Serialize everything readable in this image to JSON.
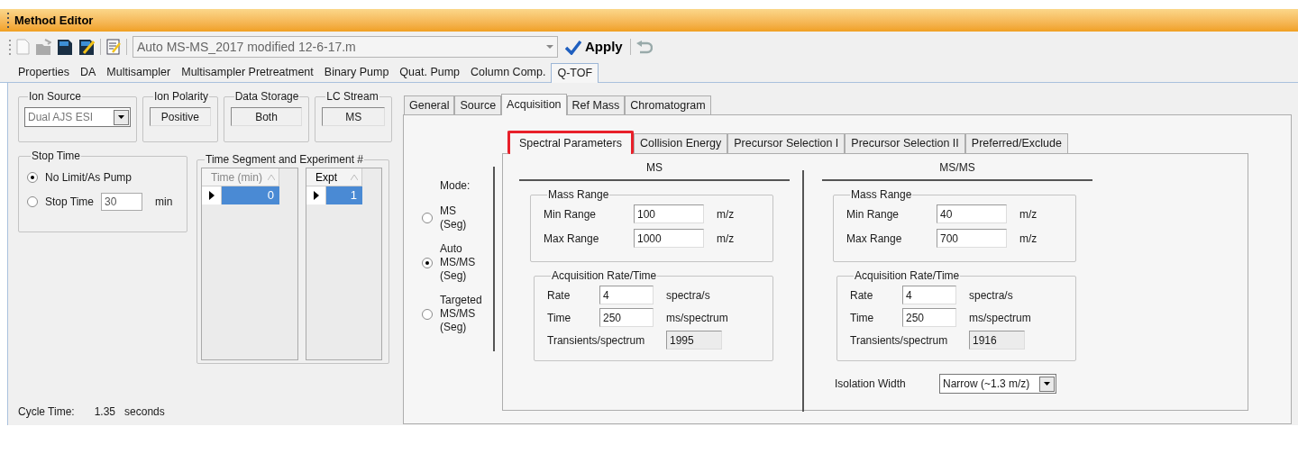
{
  "window": {
    "title": "Method Editor"
  },
  "toolbar": {
    "method_file": "Auto MS-MS_2017 modified 12-6-17.m",
    "apply_button": "Apply"
  },
  "device_tabs": [
    {
      "label": "Properties",
      "selected": false
    },
    {
      "label": "DA",
      "selected": false
    },
    {
      "label": "Multisampler",
      "selected": false
    },
    {
      "label": "Multisampler Pretreatment",
      "selected": false
    },
    {
      "label": "Binary Pump",
      "selected": false
    },
    {
      "label": "Quat. Pump",
      "selected": false
    },
    {
      "label": "Column Comp.",
      "selected": false
    },
    {
      "label": "Q-TOF",
      "selected": true
    }
  ],
  "ion_source": {
    "label": "Ion Source",
    "value": "Dual AJS ESI"
  },
  "status_groups": [
    {
      "label": "Ion Polarity",
      "value": "Positive"
    },
    {
      "label": "Data Storage",
      "value": "Both"
    },
    {
      "label": "LC Stream",
      "value": "MS"
    }
  ],
  "stop_time": {
    "label": "Stop Time",
    "options": [
      {
        "label": "No Limit/As Pump",
        "selected": true
      },
      {
        "label": "Stop Time",
        "selected": false
      }
    ],
    "value": "30",
    "unit": "min"
  },
  "time_segments": {
    "label": "Time Segment and Experiment #",
    "tables": [
      {
        "column": "Time (min)",
        "value": "0"
      },
      {
        "column": "Expt",
        "value": "1"
      }
    ]
  },
  "cycle_time": {
    "label": "Cycle Time:",
    "value": "1.35",
    "unit": "seconds"
  },
  "method_tabs": [
    {
      "label": "General",
      "selected": false
    },
    {
      "label": "Source",
      "selected": false
    },
    {
      "label": "Acquisition",
      "selected": true
    },
    {
      "label": "Ref Mass",
      "selected": false
    },
    {
      "label": "Chromatogram",
      "selected": false
    }
  ],
  "mode": {
    "label": "Mode:",
    "options": [
      {
        "lines": [
          "MS",
          "(Seg)"
        ],
        "selected": false
      },
      {
        "lines": [
          "Auto",
          "MS/MS",
          "(Seg)"
        ],
        "selected": true
      },
      {
        "lines": [
          "Targeted",
          "MS/MS",
          "(Seg)"
        ],
        "selected": false
      }
    ]
  },
  "acquisition_tabs": [
    {
      "label": "Spectral Parameters",
      "selected": true,
      "highlighted": true
    },
    {
      "label": "Collision Energy",
      "selected": false,
      "highlighted": false
    },
    {
      "label": "Precursor Selection I",
      "selected": false,
      "highlighted": false
    },
    {
      "label": "Precursor Selection II",
      "selected": false,
      "highlighted": false
    },
    {
      "label": "Preferred/Exclude",
      "selected": false,
      "highlighted": false
    }
  ],
  "sections": [
    {
      "heading": "MS",
      "mass_range": {
        "label": "Mass Range",
        "rows": [
          {
            "label": "Min Range",
            "value": "100",
            "unit": "m/z"
          },
          {
            "label": "Max Range",
            "value": "1000",
            "unit": "m/z"
          }
        ]
      },
      "acquisition": {
        "label": "Acquisition Rate/Time",
        "rows": [
          {
            "label": "Rate",
            "value": "4",
            "unit": "spectra/s",
            "disabled": false
          },
          {
            "label": "Time",
            "value": "250",
            "unit": "ms/spectrum",
            "disabled": false
          },
          {
            "label": "Transients/spectrum",
            "value": "1995",
            "disabled": true
          }
        ]
      }
    },
    {
      "heading": "MS/MS",
      "mass_range": {
        "label": "Mass Range",
        "rows": [
          {
            "label": "Min Range",
            "value": "40",
            "unit": "m/z"
          },
          {
            "label": "Max Range",
            "value": "700",
            "unit": "m/z"
          }
        ]
      },
      "acquisition": {
        "label": "Acquisition Rate/Time",
        "rows": [
          {
            "label": "Rate",
            "value": "4",
            "unit": "spectra/s",
            "disabled": false
          },
          {
            "label": "Time",
            "value": "250",
            "unit": "ms/spectrum",
            "disabled": false
          },
          {
            "label": "Transients/spectrum",
            "value": "1916",
            "disabled": true
          }
        ]
      },
      "isolation_width": {
        "label": "Isolation Width",
        "value": "Narrow (~1.3 m/z)"
      }
    }
  ]
}
